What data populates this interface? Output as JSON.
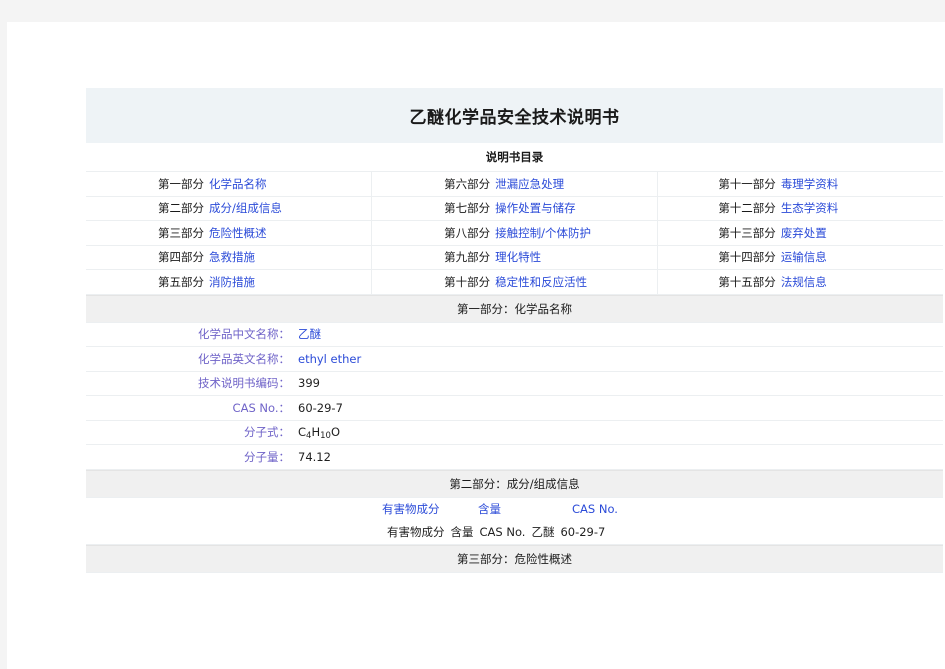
{
  "document": {
    "title": "乙醚化学品安全技术说明书",
    "toc_heading": "说明书目录"
  },
  "toc": {
    "columns": [
      {
        "entries": [
          {
            "num": "第一部分",
            "label": "化学品名称"
          },
          {
            "num": "第二部分",
            "label": "成分/组成信息"
          },
          {
            "num": "第三部分",
            "label": "危险性概述"
          },
          {
            "num": "第四部分",
            "label": "急救措施"
          },
          {
            "num": "第五部分",
            "label": "消防措施"
          }
        ]
      },
      {
        "entries": [
          {
            "num": "第六部分",
            "label": "泄漏应急处理"
          },
          {
            "num": "第七部分",
            "label": "操作处置与储存"
          },
          {
            "num": "第八部分",
            "label": "接触控制/个体防护"
          },
          {
            "num": "第九部分",
            "label": "理化特性"
          },
          {
            "num": "第十部分",
            "label": "稳定性和反应活性"
          }
        ]
      },
      {
        "entries": [
          {
            "num": "第十一部分",
            "label": "毒理学资料"
          },
          {
            "num": "第十二部分",
            "label": "生态学资料"
          },
          {
            "num": "第十三部分",
            "label": "废弃处置"
          },
          {
            "num": "第十四部分",
            "label": "运输信息"
          },
          {
            "num": "第十五部分",
            "label": "法规信息"
          }
        ]
      }
    ]
  },
  "section1": {
    "band": "第一部分：化学品名称",
    "rows": [
      {
        "label": "化学品中文名称：",
        "value": "乙醚",
        "is_link": true
      },
      {
        "label": "化学品英文名称：",
        "value": "ethyl ether",
        "is_link": true
      },
      {
        "label": "技术说明书编码：",
        "value": "399",
        "is_link": false
      },
      {
        "label": "CAS No.：",
        "value": "60-29-7",
        "is_link": false
      },
      {
        "label": "分子式：",
        "value_html": "C<sub>4</sub>H<sub>10</sub>O",
        "is_link": false
      },
      {
        "label": "分子量：",
        "value": "74.12",
        "is_link": false
      }
    ]
  },
  "section2": {
    "band": "第二部分：成分/组成信息",
    "table_headers": [
      "有害物成分",
      "含量",
      "CAS No."
    ],
    "data_row": [
      "有害物成分",
      "含量",
      "CAS No.",
      "乙醚",
      "60-29-7"
    ]
  },
  "section3": {
    "band": "第三部分：危险性概述"
  },
  "colors": {
    "title_band": "#eef3f6",
    "section_band": "#f0f0f0",
    "link": "#2b4bd8",
    "label": "#6f63c8",
    "text": "#1f1f1f",
    "border": "#eceff1",
    "page_chrome": "#f4f4f4"
  }
}
